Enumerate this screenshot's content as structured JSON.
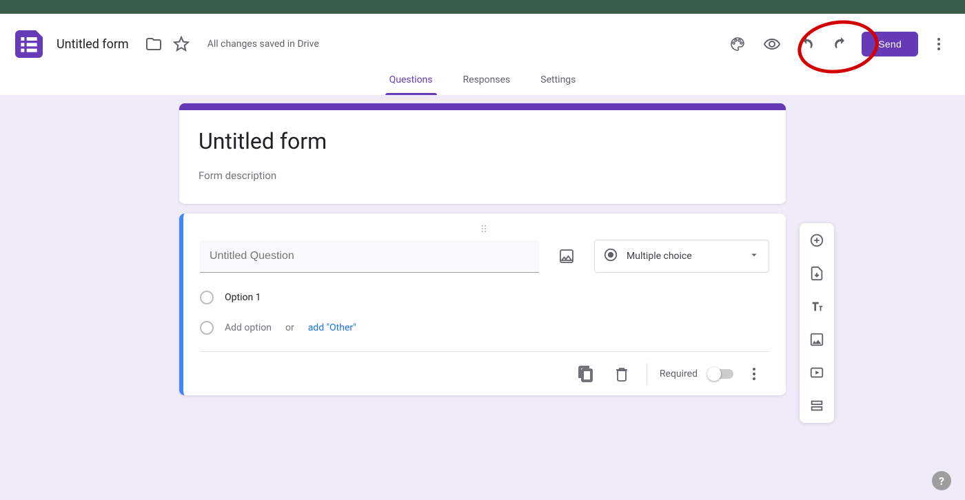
{
  "header": {
    "form_title": "Untitled form",
    "save_status": "All changes saved in Drive",
    "send_label": "Send"
  },
  "tabs": {
    "items": [
      "Questions",
      "Responses",
      "Settings"
    ],
    "active": 0
  },
  "title_card": {
    "title": "Untitled form",
    "description_placeholder": "Form description"
  },
  "question_card": {
    "question_placeholder": "Untitled Question",
    "question_type": "Multiple choice",
    "options": [
      "Option 1"
    ],
    "add_option_label": "Add option",
    "or_label": "or",
    "add_other_label": "add \"Other\"",
    "required_label": "Required",
    "required": false
  },
  "side_toolbar": {
    "items": [
      "add-question",
      "import-questions",
      "add-title",
      "add-image",
      "add-video",
      "add-section"
    ]
  },
  "help": {
    "glyph": "?"
  }
}
